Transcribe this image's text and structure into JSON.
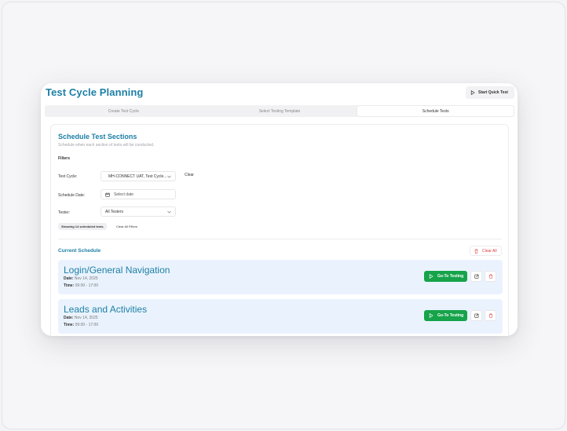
{
  "header": {
    "title": "Test Cycle Planning",
    "quick_test_label": "Start Quick Test"
  },
  "steps": [
    {
      "label": "Create Test Cycle",
      "active": false
    },
    {
      "label": "Select Testing Template",
      "active": false
    },
    {
      "label": "Schedule Tests",
      "active": true
    }
  ],
  "section": {
    "title": "Schedule Test Sections",
    "subtitle": "Schedule when each section of tests will be conducted."
  },
  "filters": {
    "heading": "Filters",
    "test_cycle_label": "Test Cycle:",
    "test_cycle_value": "MH-CONNECT UAT, Test Cycle...",
    "clear_label": "Clear",
    "schedule_date_label": "Schedule Date:",
    "schedule_date_placeholder": "Select date",
    "tester_label": "Tester:",
    "tester_value": "All Testers",
    "showing_chip": "Showing 14 scheduled tests",
    "clear_all_filters": "Clear All Filters"
  },
  "schedule": {
    "title": "Current Schedule",
    "clear_all_label": "Clear All",
    "go_label": "Go-To Testing",
    "items": [
      {
        "name": "Login/General Navigation",
        "date_label": "Date:",
        "date": "Nov 14, 2025",
        "time_label": "Time:",
        "time": "09:00 - 17:00"
      },
      {
        "name": "Leads and Activities",
        "date_label": "Date:",
        "date": "Nov 14, 2025",
        "time_label": "Time:",
        "time": "09:00 - 17:00"
      }
    ]
  },
  "colors": {
    "accent": "#1d7fa6",
    "success": "#16a34a",
    "danger": "#e13b3b",
    "row_bg": "#eaf3fd"
  }
}
